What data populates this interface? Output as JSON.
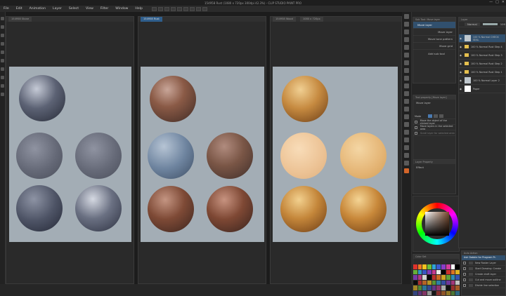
{
  "window": {
    "title": "154958 Rust (1080 x 720px 300dpi 42.3%) - CLIP STUDIO PAINT PRO",
    "minimize": "—",
    "maximize": "□",
    "close": "✕"
  },
  "menu": [
    "File",
    "Edit",
    "Animation",
    "Layer",
    "Select",
    "View",
    "Filter",
    "Window",
    "Help"
  ],
  "canvas_tabs": [
    {
      "label": "154958 Stone",
      "active": false
    },
    {
      "label": "154958 Rust",
      "active": true
    },
    {
      "label": "154958 Wood",
      "active": false
    },
    {
      "label": "1080 x 720px",
      "active": false
    }
  ],
  "sub_tool": {
    "header": "Sub Tool: Move layer",
    "items": [
      "Move layer",
      "Move layer",
      "Move tone pattern",
      "Move grid"
    ],
    "add": "Add sub tool"
  },
  "tool_property": {
    "header": "Tool property [Move layer]",
    "title": "Move layer",
    "mode_label": "Mode",
    "options": [
      "Move the object of the clicked layer",
      "Move layers in the selected area",
      "Scroll layer for selected area"
    ]
  },
  "layer_property": {
    "header": "Layer Property",
    "effect": "Effect"
  },
  "layers": {
    "header": "Layer",
    "blend": "Normal",
    "opacity": "100",
    "items": [
      {
        "name": "100 % Normal  CHECK SEAL"
      },
      {
        "name": "100 % Normal  Rust Step 4"
      },
      {
        "name": "100 % Normal  Rust Step 3"
      },
      {
        "name": "100 % Normal  Rust Step 2"
      },
      {
        "name": "100 % Normal  Rust Step 1"
      },
      {
        "name": "100 % Normal  Layer 2"
      },
      {
        "name": "Paper"
      }
    ]
  },
  "auto_actions": {
    "header": "Auto Action",
    "set": "Ash Dabble for Program Pr.",
    "items": [
      "New Raster Layer",
      "Start Drawing: Create",
      "Create draft layer",
      "Cut and move outline",
      "Divide line selection"
    ]
  },
  "color_set": {
    "header": "Color Set"
  },
  "colors": {
    "stone": "#5f6371",
    "rust": "#7a4e38",
    "wood": "#c8893f",
    "paper": "#a3adb5"
  }
}
